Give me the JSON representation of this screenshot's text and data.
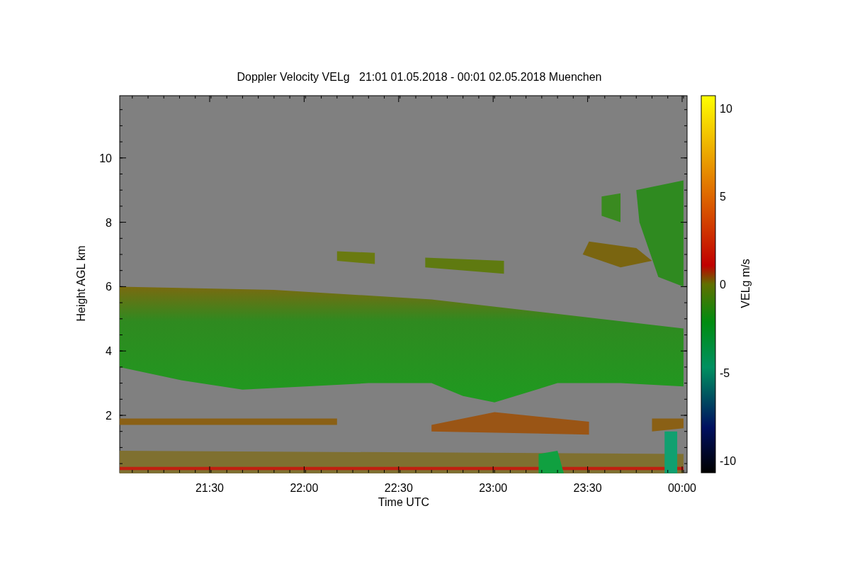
{
  "chart": {
    "title": "Doppler Velocity VELg   21:01 01.05.2018 - 00:01 02.05.2018 Muenchen",
    "xlabel": "Time UTC",
    "ylabel": "Height AGL km",
    "x_tick_labels": [
      "21:30",
      "22:00",
      "22:30",
      "23:00",
      "23:30",
      "00:00"
    ],
    "y_tick_labels": [
      "10",
      "8",
      "6",
      "4",
      "2"
    ],
    "colorbar": {
      "label": "VELg m/s",
      "tick_labels": [
        "10",
        "5",
        "0",
        "-5",
        "-10"
      ]
    }
  }
}
